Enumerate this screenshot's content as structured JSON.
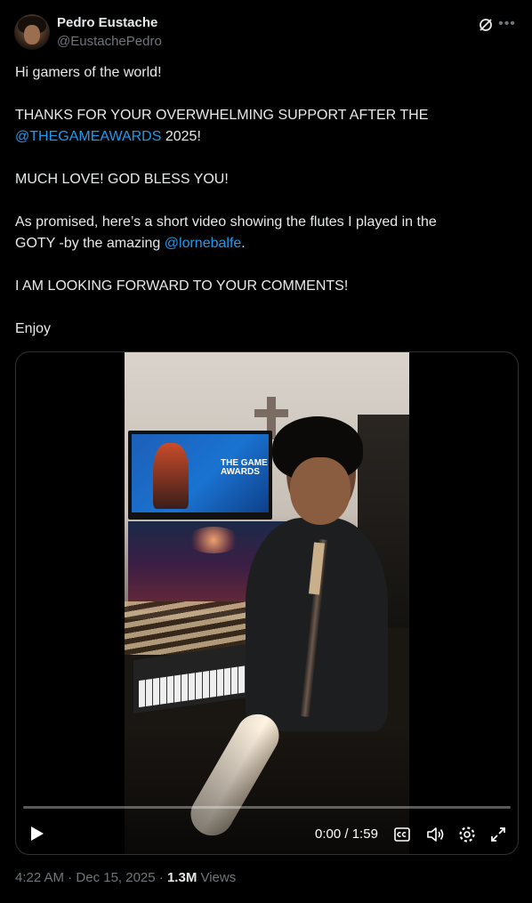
{
  "author": {
    "name": "Pedro Eustache",
    "handle": "@EustachePedro"
  },
  "tweet": {
    "line1": "Hi gamers of the world!",
    "line2_a": "THANKS FOR YOUR OVERWHELMING SUPPORT AFTER THE",
    "line2_mention": "@THEGAMEAWARDS",
    "line2_b": " 2025!",
    "line3": "MUCH LOVE! GOD BLESS YOU!",
    "line4_a": "As promised, here’s a short video showing the flutes I played in the",
    "line4_b": "GOTY -by the amazing ",
    "line4_mention": "@lornebalfe",
    "line4_c": ".",
    "line5": "I AM LOOKING FORWARD TO YOUR COMMENTS!",
    "line6": "Enjoy"
  },
  "video": {
    "tv_logo_text": "THE GAME AWARDS",
    "current_time": "0:00",
    "separator": " / ",
    "duration": "1:59",
    "progress_fraction": 0.0
  },
  "meta": {
    "time": "4:22 AM",
    "dot1": " · ",
    "date": "Dec 15, 2025",
    "dot2": " · ",
    "views_count": "1.3M",
    "views_label": " Views"
  },
  "colors": {
    "background": "#000000",
    "text": "#e7e9ea",
    "secondary": "#71767b",
    "link": "#1d9bf0",
    "border": "#2f3336"
  },
  "icons": [
    "grok-icon",
    "more-icon",
    "play-icon",
    "cc-icon",
    "volume-icon",
    "settings-icon",
    "fullscreen-icon"
  ]
}
